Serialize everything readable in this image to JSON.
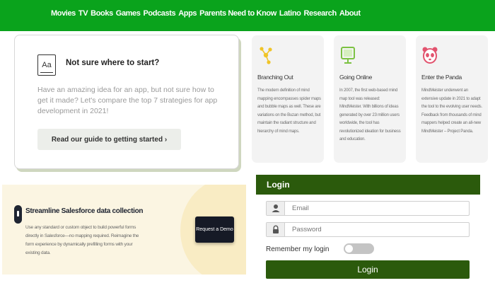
{
  "nav": {
    "items": [
      "Movies",
      "TV",
      "Books",
      "Games",
      "Podcasts",
      "Apps",
      "Parents Need to Know",
      "Latino",
      "Research",
      "About"
    ]
  },
  "start_card": {
    "icon_text": "Aa",
    "title": "Not sure where to start?",
    "description": "Have an amazing idea for an app, but not sure how to get it made? Let's compare the top 7 strategies for app development in 2021!",
    "button_label": "Read our guide to getting started ›"
  },
  "features": [
    {
      "title": "Branching Out",
      "text": "The modern definition of mind mapping encompasses spider maps and bubble maps as well. These are variations on the Buzan method, but maintain the radiant structure and hierarchy of mind maps.",
      "icon": "branch-icon",
      "color": "#f0c428"
    },
    {
      "title": "Going Online",
      "text": "In 2007, the first web-based mind map tool was released: MindMeister. With billions of ideas generated by over 23 million users worldwide, the tool has revolutionized ideation for business and education.",
      "icon": "monitor-icon",
      "color": "#7cc242"
    },
    {
      "title": "Enter the Panda",
      "text": "MindMeister underwent an extensive update in 2021 to adapt the tool to the evolving user needs. Feedback from thousands of mind mappers helped create an all-new MindMeister – Project Panda.",
      "icon": "panda-icon",
      "color": "#e2536e"
    }
  ],
  "salesforce": {
    "title": "Streamline Salesforce data collection",
    "text": "Use any standard or custom object to build powerful forms directly in Salesforce—no mapping required. Reimagine the form experience by dynamically prefilling forms with your existing data.",
    "button_label": "Request a Demo"
  },
  "login": {
    "header": "Login",
    "email_placeholder": "Email",
    "password_placeholder": "Password",
    "remember_label": "Remember my login",
    "submit_label": "Login"
  },
  "colors": {
    "nav_bg": "#0aa31c",
    "login_green": "#2b5a0c",
    "banner_bg": "#fbf5e2",
    "demo_button": "#161a26"
  }
}
